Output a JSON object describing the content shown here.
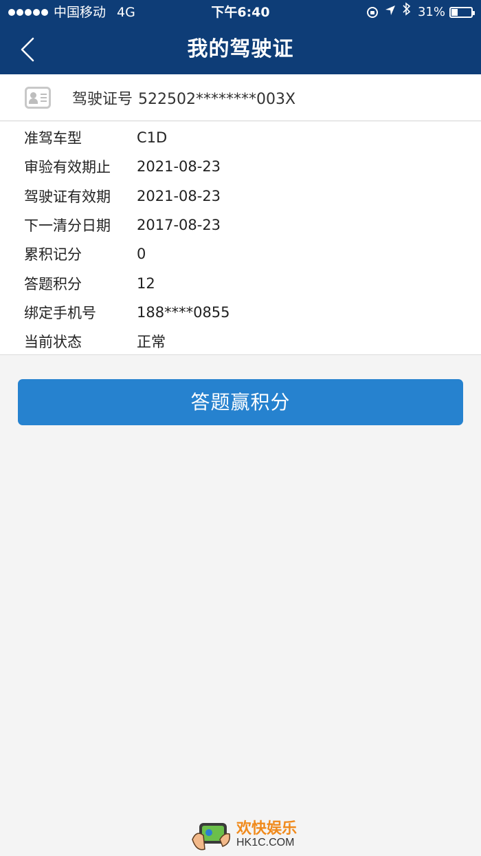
{
  "status_bar": {
    "carrier": "中国移动",
    "network": "4G",
    "time": "下午6:40",
    "battery_percent": "31%",
    "battery_level": 0.31,
    "icons": [
      "orientation-lock-icon",
      "location-arrow-icon",
      "bluetooth-icon",
      "battery-icon"
    ]
  },
  "header": {
    "title": "我的驾驶证",
    "back_icon": "chevron-left-icon",
    "background_color": "#0e3d77"
  },
  "license": {
    "icon": "id-card-icon",
    "label": "驾驶证号",
    "number": "522502********003X"
  },
  "details": [
    {
      "label": "准驾车型",
      "value": "C1D"
    },
    {
      "label": "审验有效期止",
      "value": "2021-08-23"
    },
    {
      "label": "驾驶证有效期",
      "value": "2021-08-23"
    },
    {
      "label": "下一清分日期",
      "value": "2017-08-23"
    },
    {
      "label": "累积记分",
      "value": "0"
    },
    {
      "label": "答题积分",
      "value": "12"
    },
    {
      "label": "绑定手机号",
      "value": "188****0855"
    },
    {
      "label": "当前状态",
      "value": "正常"
    }
  ],
  "action_button": {
    "label": "答题赢积分",
    "color": "#2682cf"
  },
  "watermark": {
    "name": "欢快娱乐",
    "domain": "HK1C.COM"
  }
}
